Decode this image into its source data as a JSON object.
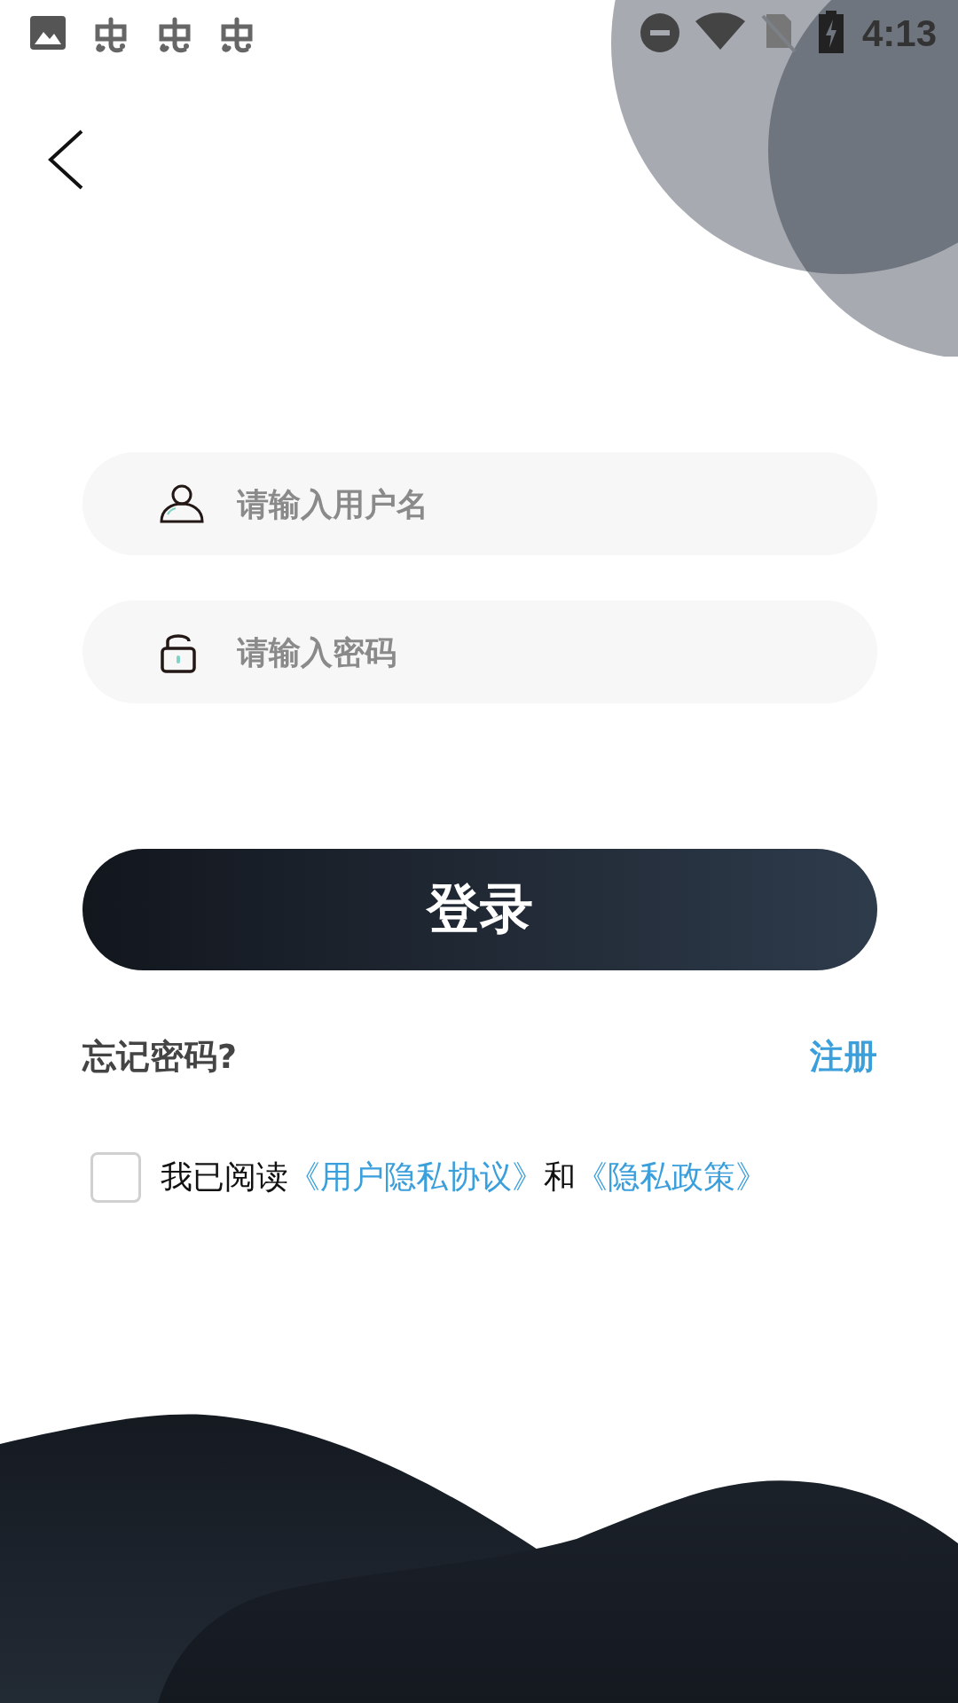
{
  "status_bar": {
    "time": "4:13"
  },
  "username_field": {
    "placeholder": "请输入用户名"
  },
  "password_field": {
    "placeholder": "请输入密码"
  },
  "login_button": {
    "label": "登录"
  },
  "forgot_password": "忘记密码?",
  "register": "注册",
  "agreement": {
    "checked": false,
    "text_before": "我已阅读",
    "link_1": "《用户隐私协议》",
    "text_middle": "和",
    "link_2": "《隐私政策》"
  }
}
